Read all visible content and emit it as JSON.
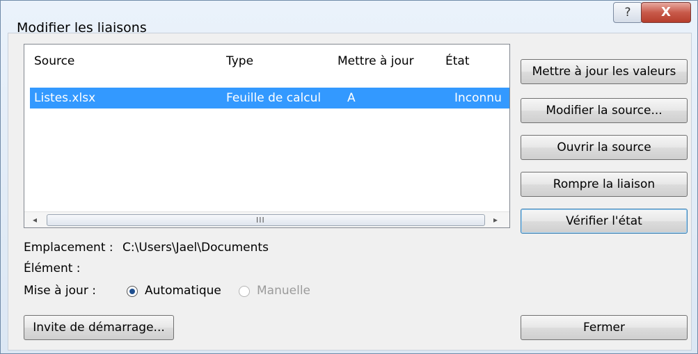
{
  "window": {
    "title": "Modifier les liaisons",
    "help_label": "?",
    "close_label": "X"
  },
  "list": {
    "columns": [
      "Source",
      "Type",
      "Mettre à jour",
      "État"
    ],
    "rows": [
      {
        "source": "Listes.xlsx",
        "type": "Feuille de calcul",
        "update": "A",
        "state": "Inconnu",
        "selected": true
      }
    ],
    "scroll": {
      "left_arrow": "◂",
      "right_arrow": "▸",
      "grip": "III"
    }
  },
  "buttons": {
    "update_values": "Mettre à jour les valeurs",
    "change_source": "Modifier la source...",
    "open_source": "Ouvrir la source",
    "break_link": "Rompre la liaison",
    "check_status": "Vérifier l'état",
    "startup_prompt": "Invite de démarrage...",
    "close": "Fermer"
  },
  "details": {
    "location_label": "Emplacement :",
    "location_value": "C:\\Users\\Jael\\Documents",
    "item_label": "Élément :",
    "item_value": "",
    "update_label": "Mise à jour :",
    "auto_label": "Automatique",
    "manual_label": "Manuelle"
  },
  "colors": {
    "selection": "#3399ff",
    "close_button": "#c85a4a"
  }
}
